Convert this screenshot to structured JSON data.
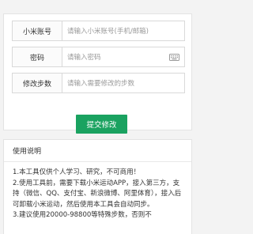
{
  "header": {
    "title_partial": ""
  },
  "form": {
    "account": {
      "label": "小米账号",
      "placeholder": "请输入小米账号(手机/邮箱)"
    },
    "password": {
      "label": "密码",
      "placeholder": "请输入密码",
      "icon": "keyboard-icon"
    },
    "steps": {
      "label": "修改步数",
      "placeholder": "请输入需要修改的步数"
    },
    "submit_label": "提交修改"
  },
  "instructions": {
    "title": "使用说明",
    "items": [
      "1.本工具仅供个人学习、研究，不可商用！",
      "2.使用工具前，需要下载小米运动APP，接入第三方，支持（微信、QQ、支付宝、新浪微博、阿里体育），接入后可卸载小米运动，然后使用本工具会自动同步。",
      "3.建议使用20000-98800等特殊步数，否则不"
    ]
  },
  "colors": {
    "accent": "#1aa260",
    "border": "#d9d9d9",
    "background": "#f3f3f3"
  }
}
